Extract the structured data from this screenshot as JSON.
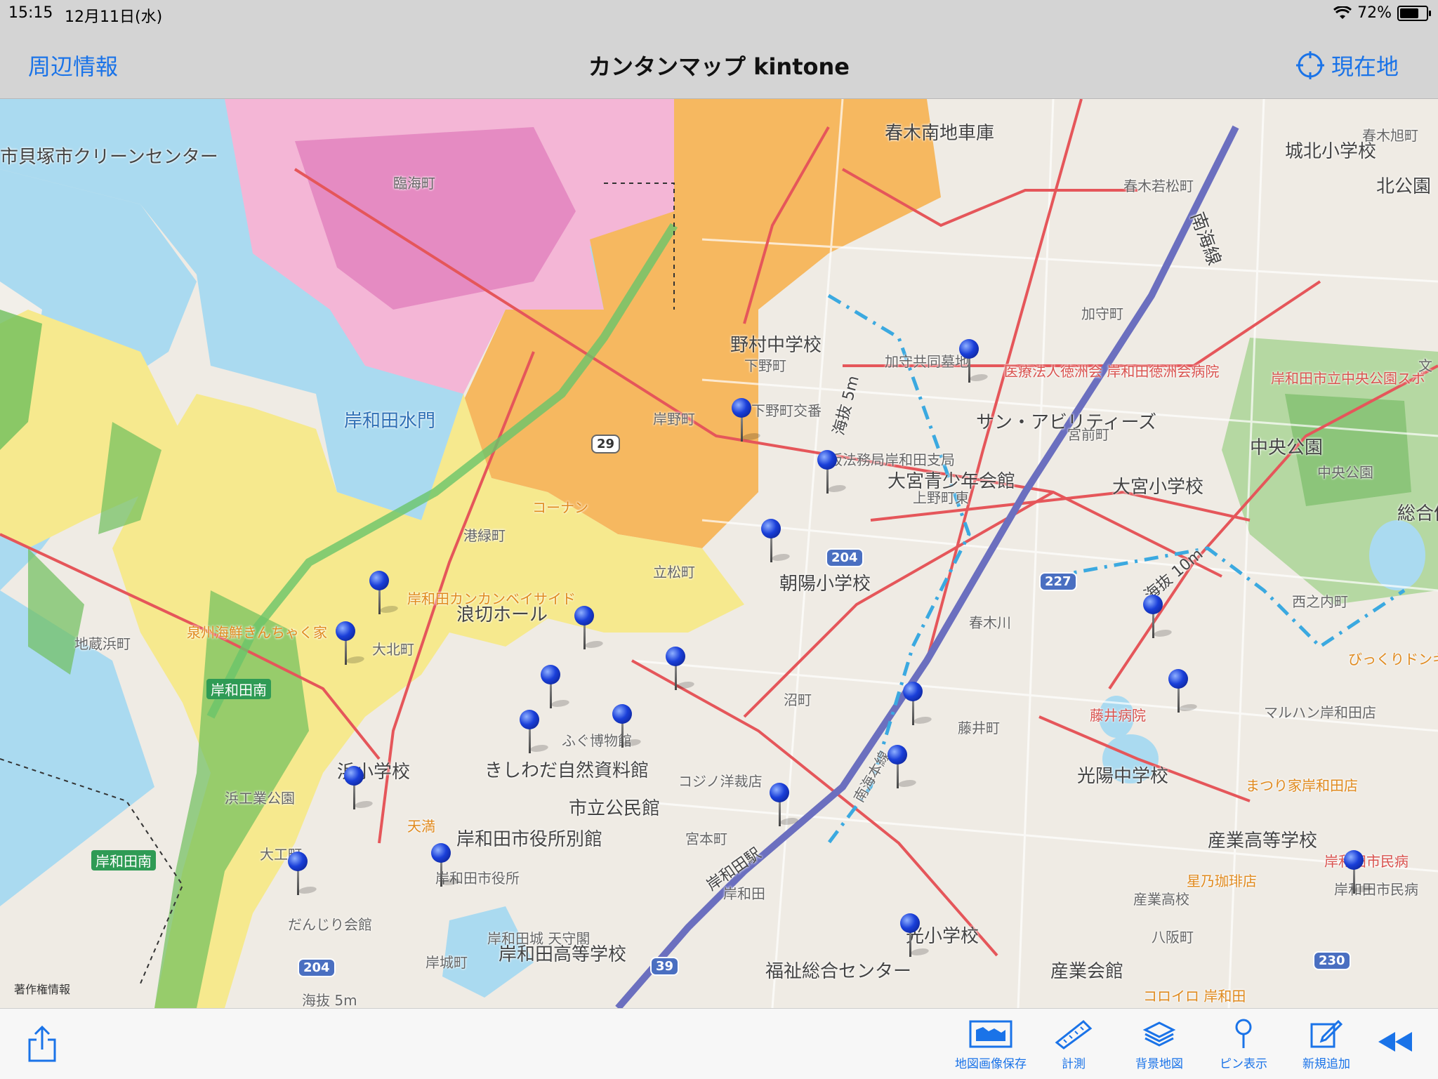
{
  "status": {
    "time": "15:15",
    "date": "12月11日(水)",
    "battery": "72%",
    "battery_level": 0.72
  },
  "nav": {
    "left": "周辺情報",
    "title": "カンタンマップ kintone",
    "right": "現在地"
  },
  "map": {
    "labels": [
      "春木南地車庫",
      "城北小学校",
      "北公園",
      "春木旭町",
      "春木若松町",
      "市貝塚市クリーンセンター",
      "臨海町",
      "南海線",
      "加守町",
      "野村中学校",
      "下野町",
      "加守共同墓地",
      "医療法人徳洲会 岸和田徳洲会病院",
      "岸和田市立中央公園スポ",
      "文",
      "岸和田水門",
      "岸野町",
      "下野町交番",
      "海抜 5m",
      "サン・アビリティーズ",
      "宮前町",
      "中央公園",
      "中央公園",
      "大宮青少年会館",
      "大宮小学校",
      "上野町東",
      "総合体",
      "阪法務局岸和田支局",
      "コーナン",
      "朝陽小学校",
      "港緑町",
      "立松町",
      "岸和田カンカンベイサイド",
      "浪切ホール",
      "海抜 10m",
      "西之内町",
      "泉州海鮮きんちゃく家",
      "大北町",
      "地蔵浜町",
      "岸和田南",
      "沼町",
      "藤井町",
      "藤井病院",
      "マルハン岸和田店",
      "びっくりドンキ",
      "ふぐ博物館",
      "きしわだ自然資料館",
      "コジノ洋裁店",
      "光陽中学校",
      "浜小学校",
      "浜工業公園",
      "天満",
      "市立公民館",
      "まつり家岸和田店",
      "岸和田市役所別館",
      "宮本町",
      "岸和田駅",
      "岸和田",
      "産業高等学校",
      "岸和田市役所",
      "岸和田南",
      "大工町",
      "岸和田市民病",
      "星乃珈琲店",
      "産業高校",
      "だんじり会館",
      "岸和田城 天守閣",
      "岸和田高等学校",
      "光小学校",
      "八阪町",
      "福祉総合センター",
      "岸城町",
      "産業会館",
      "コロイロ 岸和田",
      "海抜 5m",
      "南海本線",
      "春木川",
      "岸和田市民病"
    ],
    "routes": [
      "29",
      "204",
      "227",
      "204",
      "39",
      "230"
    ],
    "copyright": "著作権情報"
  },
  "toolbar": {
    "items": [
      "地図画像保存",
      "計測",
      "背景地図",
      "ピン表示",
      "新規追加"
    ]
  }
}
